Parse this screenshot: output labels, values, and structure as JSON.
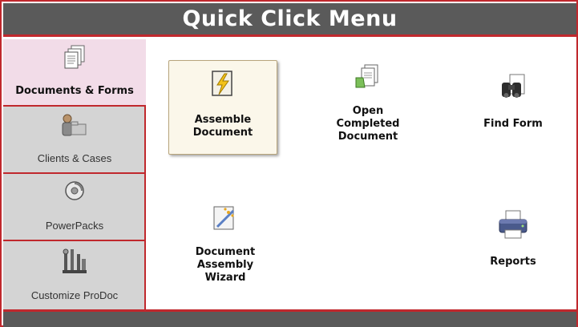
{
  "title": "Quick Click Menu",
  "colors": {
    "accent": "#c0282d",
    "bar": "#5a5a5a",
    "sidebar": "#d4d4d4",
    "active": "#f2dce8"
  },
  "sidebar": {
    "items": [
      {
        "label": "Documents & Forms",
        "icon": "documents-stack-icon",
        "active": true
      },
      {
        "label": "Clients & Cases",
        "icon": "client-folder-icon",
        "active": false
      },
      {
        "label": "PowerPacks",
        "icon": "disc-icon",
        "active": false
      },
      {
        "label": "Customize ProDoc",
        "icon": "tools-icon",
        "active": false
      }
    ]
  },
  "main": {
    "tiles": [
      {
        "label": "Assemble\nDocument",
        "icon": "lightning-document-icon",
        "selected": true
      },
      {
        "label": "Open\nCompleted\nDocument",
        "icon": "open-document-icon",
        "selected": false
      },
      {
        "label": "Find Form",
        "icon": "binoculars-icon",
        "selected": false
      },
      {
        "label": "Document\nAssembly\nWizard",
        "icon": "wizard-wand-icon",
        "selected": false
      },
      {
        "label": "Reports",
        "icon": "printer-icon",
        "selected": false
      }
    ]
  }
}
